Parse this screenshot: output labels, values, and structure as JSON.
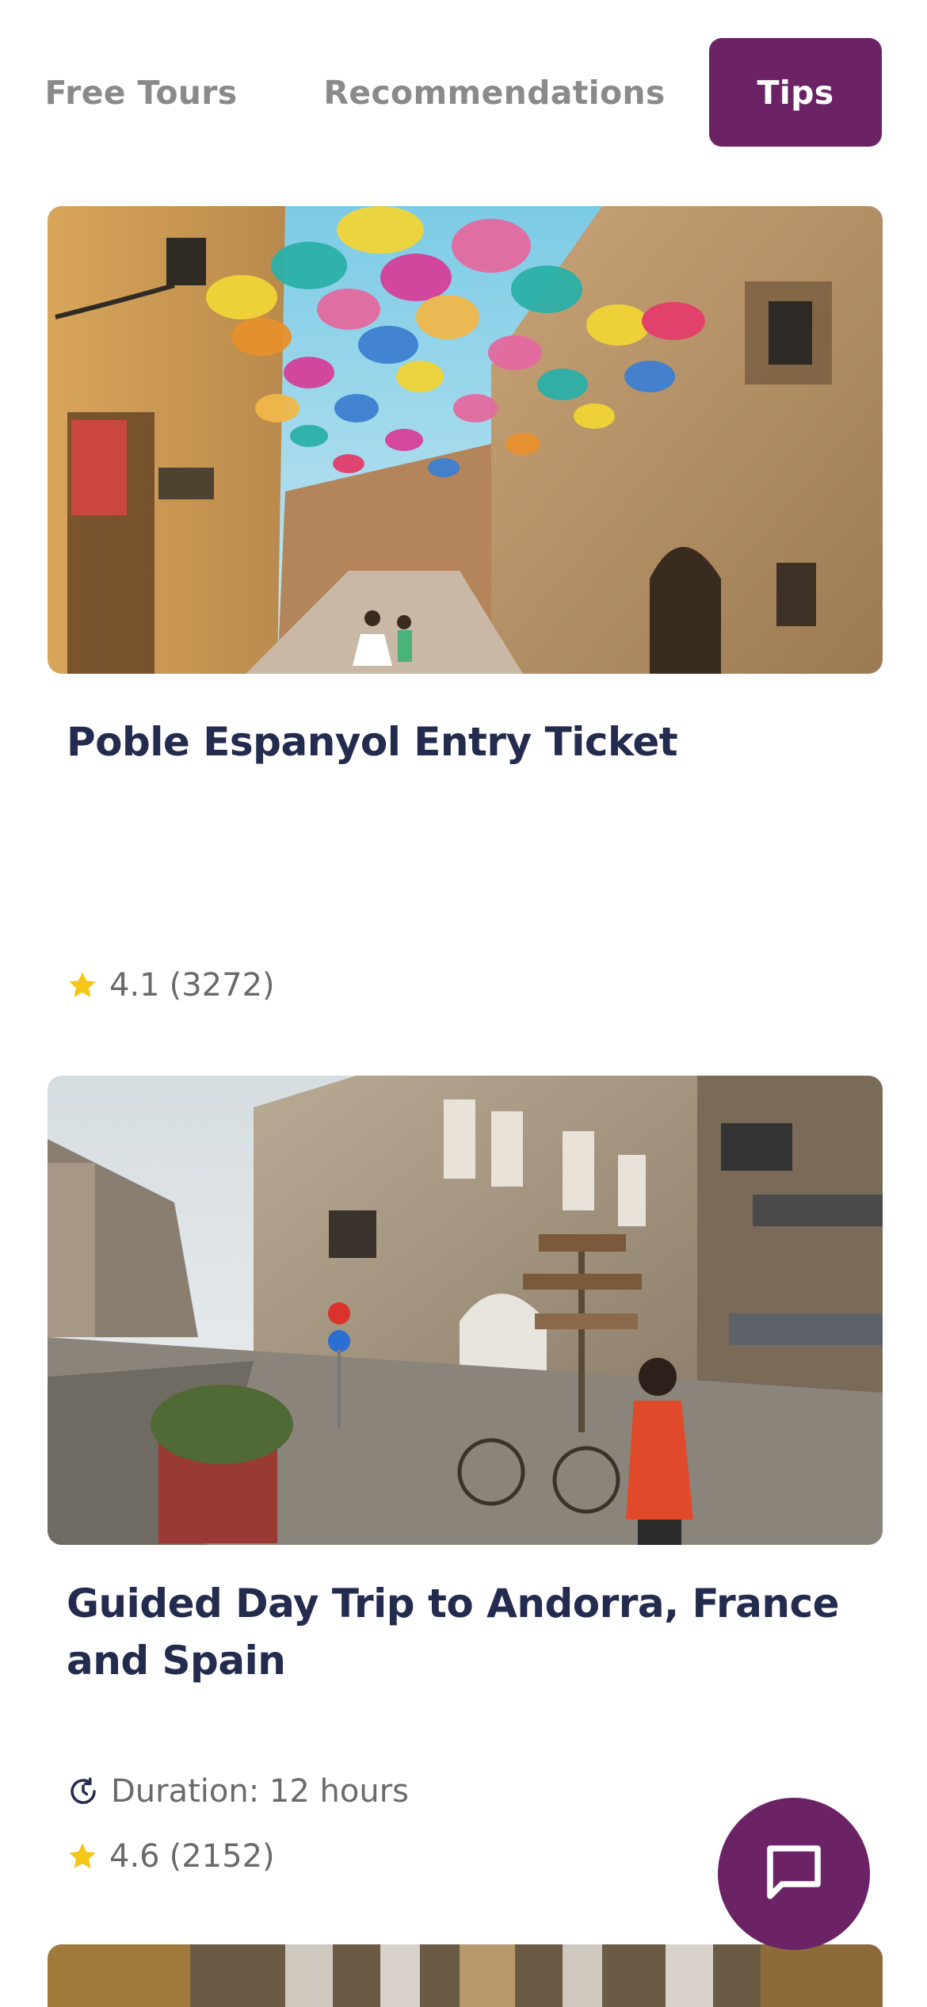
{
  "tabs": [
    {
      "label": "Free Tours"
    },
    {
      "label": "Recommendations"
    },
    {
      "label": "Tips",
      "active": true
    }
  ],
  "cards": [
    {
      "title": "Poble Espanyol Entry Ticket",
      "rating": "4.1",
      "reviews": "(3272)"
    },
    {
      "title": "Guided Day Trip to Andorra, France and Spain",
      "duration": "Duration: 12 hours",
      "rating": "4.6",
      "reviews": "(2152)"
    }
  ],
  "colors": {
    "accent": "#6b2366",
    "title": "#232b4e",
    "star": "#f5c518",
    "muted": "#8a8a8a"
  },
  "icons": {
    "chat": "chat-bubble-icon",
    "star": "star-icon",
    "clock": "clock-icon"
  }
}
